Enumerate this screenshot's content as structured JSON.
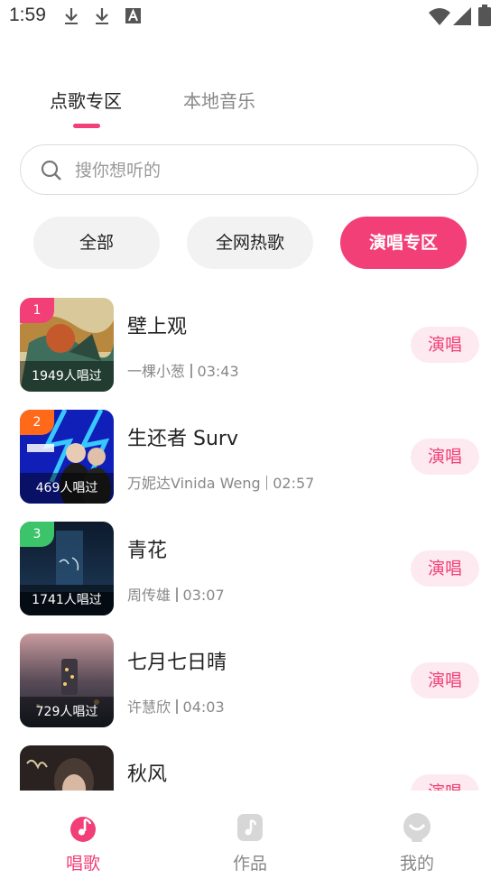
{
  "status_bar": {
    "time": "1:59"
  },
  "tabs": [
    {
      "label": "点歌专区"
    },
    {
      "label": "本地音乐"
    }
  ],
  "search": {
    "placeholder": "搜你想听的"
  },
  "filters": [
    {
      "label": "全部"
    },
    {
      "label": "全网热歌"
    },
    {
      "label": "演唱专区"
    }
  ],
  "songs": [
    {
      "rank": "1",
      "title": "壁上观",
      "artist": "一棵小葱",
      "duration": "03:43",
      "sung": "1949人唱过",
      "button": "演唱"
    },
    {
      "rank": "2",
      "title": "生还者 Surv",
      "artist": "万妮达Vinida Weng",
      "duration": "02:57",
      "sung": "469人唱过",
      "button": "演唱"
    },
    {
      "rank": "3",
      "title": "青花",
      "artist": "周传雄",
      "duration": "03:07",
      "sung": "1741人唱过",
      "button": "演唱"
    },
    {
      "rank": "",
      "title": "七月七日晴",
      "artist": "许慧欣",
      "duration": "04:03",
      "sung": "729人唱过",
      "button": "演唱"
    },
    {
      "rank": "",
      "title": "秋风",
      "artist": "",
      "duration": "",
      "sung": "",
      "button": "演唱"
    }
  ],
  "bottom_nav": [
    {
      "label": "唱歌"
    },
    {
      "label": "作品"
    },
    {
      "label": "我的"
    }
  ],
  "colors": {
    "accent": "#f23f77",
    "rank1": "#f23f77",
    "rank2": "#ff6a1a",
    "rank3": "#3cc46a"
  }
}
